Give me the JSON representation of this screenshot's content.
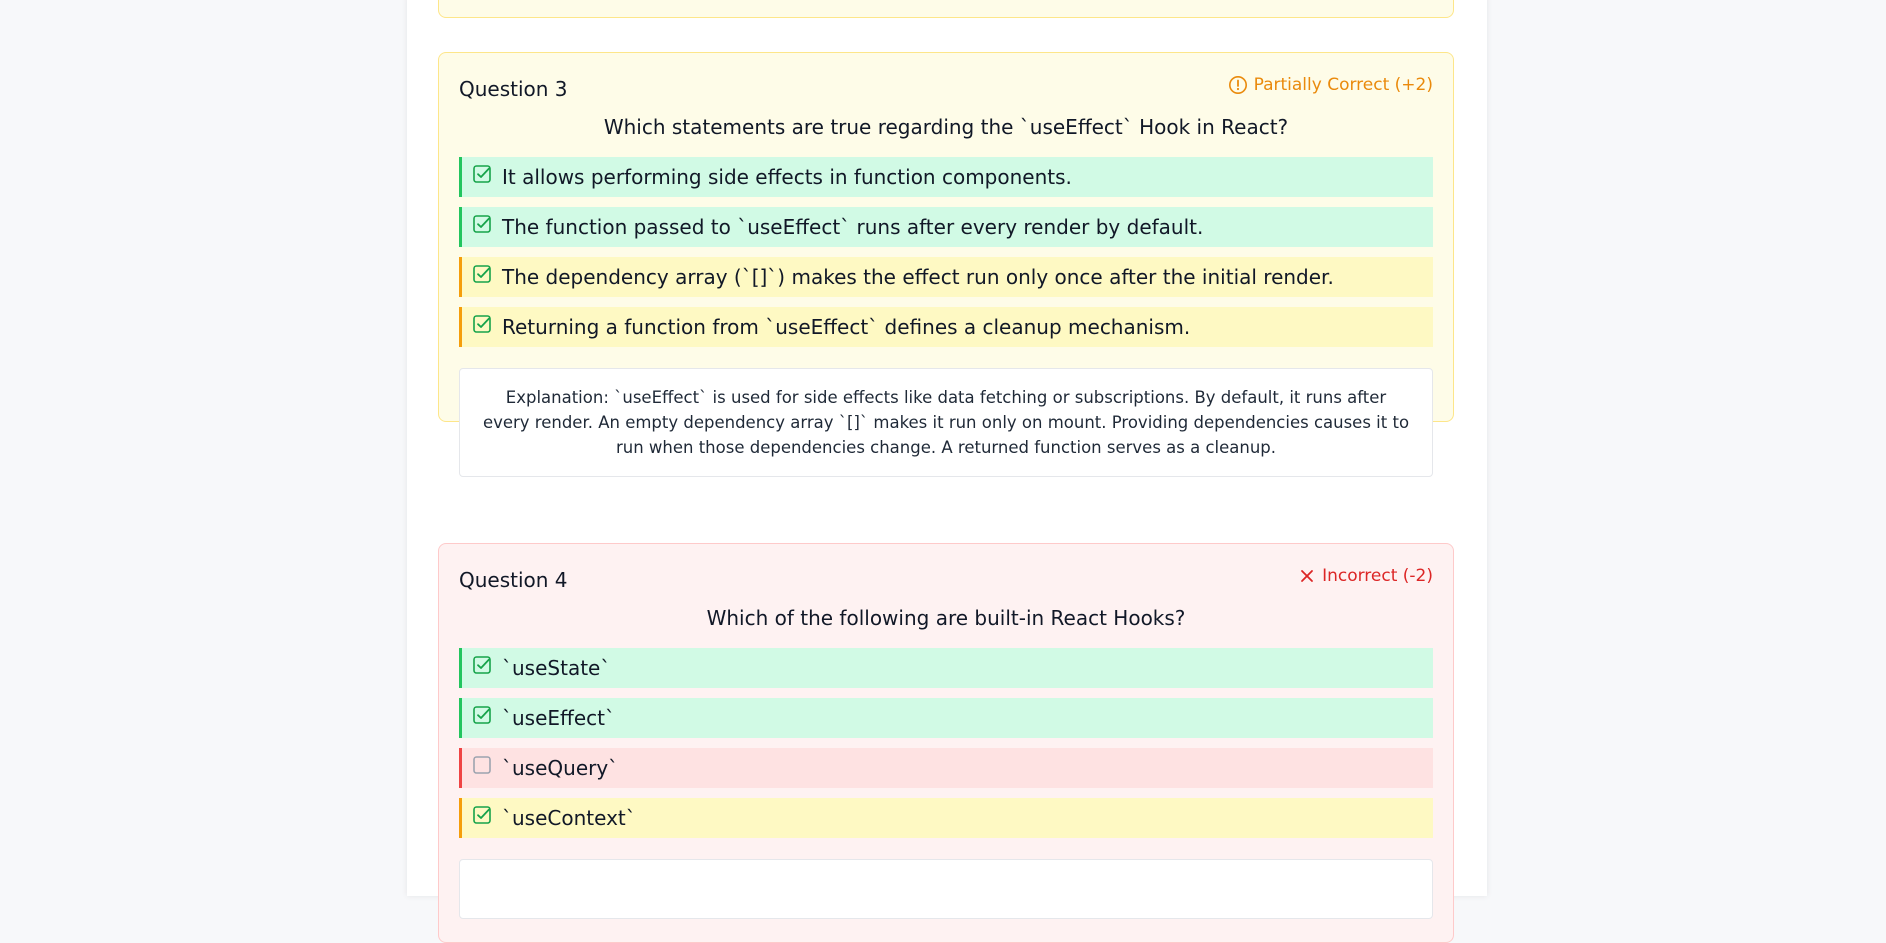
{
  "questions": [
    {
      "label": "Question 3",
      "status": "Partially Correct (+2)",
      "status_type": "partial",
      "status_icon": "alert-circle-icon",
      "text": "Which statements are true regarding the `useEffect` Hook in React?",
      "options": [
        {
          "text": "It allows performing side effects in function components.",
          "state": "correct",
          "checked": true
        },
        {
          "text": "The function passed to `useEffect` runs after every render by default.",
          "state": "correct",
          "checked": true
        },
        {
          "text": "The dependency array (`[]`) makes the effect run only once after the initial render.",
          "state": "missed",
          "checked": true
        },
        {
          "text": "Returning a function from `useEffect` defines a cleanup mechanism.",
          "state": "missed",
          "checked": true
        }
      ],
      "explanation": "Explanation: `useEffect` is used for side effects like data fetching or subscriptions. By default, it runs after every render. An empty dependency array `[]` makes it run only on mount. Providing dependencies causes it to run when those dependencies change. A returned function serves as a cleanup."
    },
    {
      "label": "Question 4",
      "status": "Incorrect (-2)",
      "status_type": "incorrect",
      "status_icon": "x-icon",
      "text": "Which of the following are built-in React Hooks?",
      "options": [
        {
          "text": "`useState`",
          "state": "correct",
          "checked": true
        },
        {
          "text": "`useEffect`",
          "state": "correct",
          "checked": true
        },
        {
          "text": "`useQuery`",
          "state": "wrong",
          "checked": false
        },
        {
          "text": "`useContext`",
          "state": "missed",
          "checked": true
        }
      ]
    }
  ],
  "colors": {
    "correct_bg": "#d1fae5",
    "missed_bg": "#fef9c3",
    "wrong_bg": "#fee2e2",
    "partial_text": "#ea8a0c",
    "incorrect_text": "#dc2626"
  }
}
